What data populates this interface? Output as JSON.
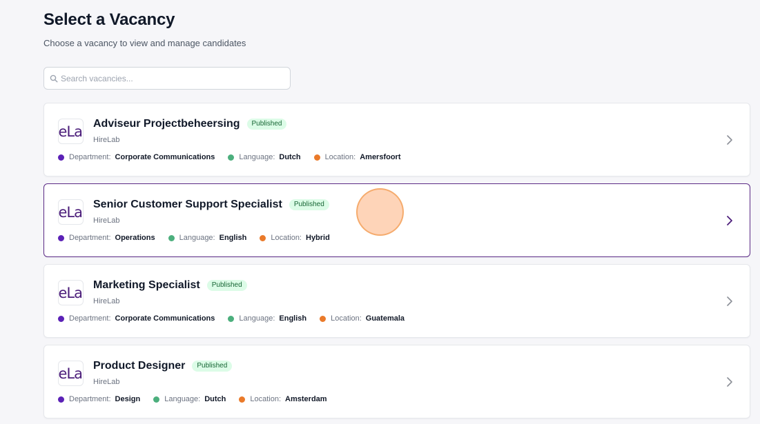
{
  "header": {
    "title": "Select a Vacancy",
    "subtitle": "Choose a vacancy to view and manage candidates"
  },
  "search": {
    "placeholder": "Search vacancies...",
    "value": ""
  },
  "labels": {
    "department": "Department:",
    "language": "Language:",
    "location": "Location:"
  },
  "colors": {
    "accent": "#5b2a86",
    "department_dot": "#5b21b6",
    "language_dot": "#4caf7d",
    "location_dot": "#ea7a2a",
    "badge_bg": "#dcfce7",
    "badge_text": "#166534"
  },
  "vacancies": [
    {
      "title": "Adviseur Projectbeheersing",
      "status": "Published",
      "company": "HireLab",
      "logo_text": "eLa",
      "department": "Corporate Communications",
      "language": "Dutch",
      "location": "Amersfoort"
    },
    {
      "title": "Senior Customer Support Specialist",
      "status": "Published",
      "company": "HireLab",
      "logo_text": "eLa",
      "department": "Operations",
      "language": "English",
      "location": "Hybrid"
    },
    {
      "title": "Marketing Specialist",
      "status": "Published",
      "company": "HireLab",
      "logo_text": "eLa",
      "department": "Corporate Communications",
      "language": "English",
      "location": "Guatemala"
    },
    {
      "title": "Product Designer",
      "status": "Published",
      "company": "HireLab",
      "logo_text": "eLa",
      "department": "Design",
      "language": "Dutch",
      "location": "Amsterdam"
    }
  ]
}
